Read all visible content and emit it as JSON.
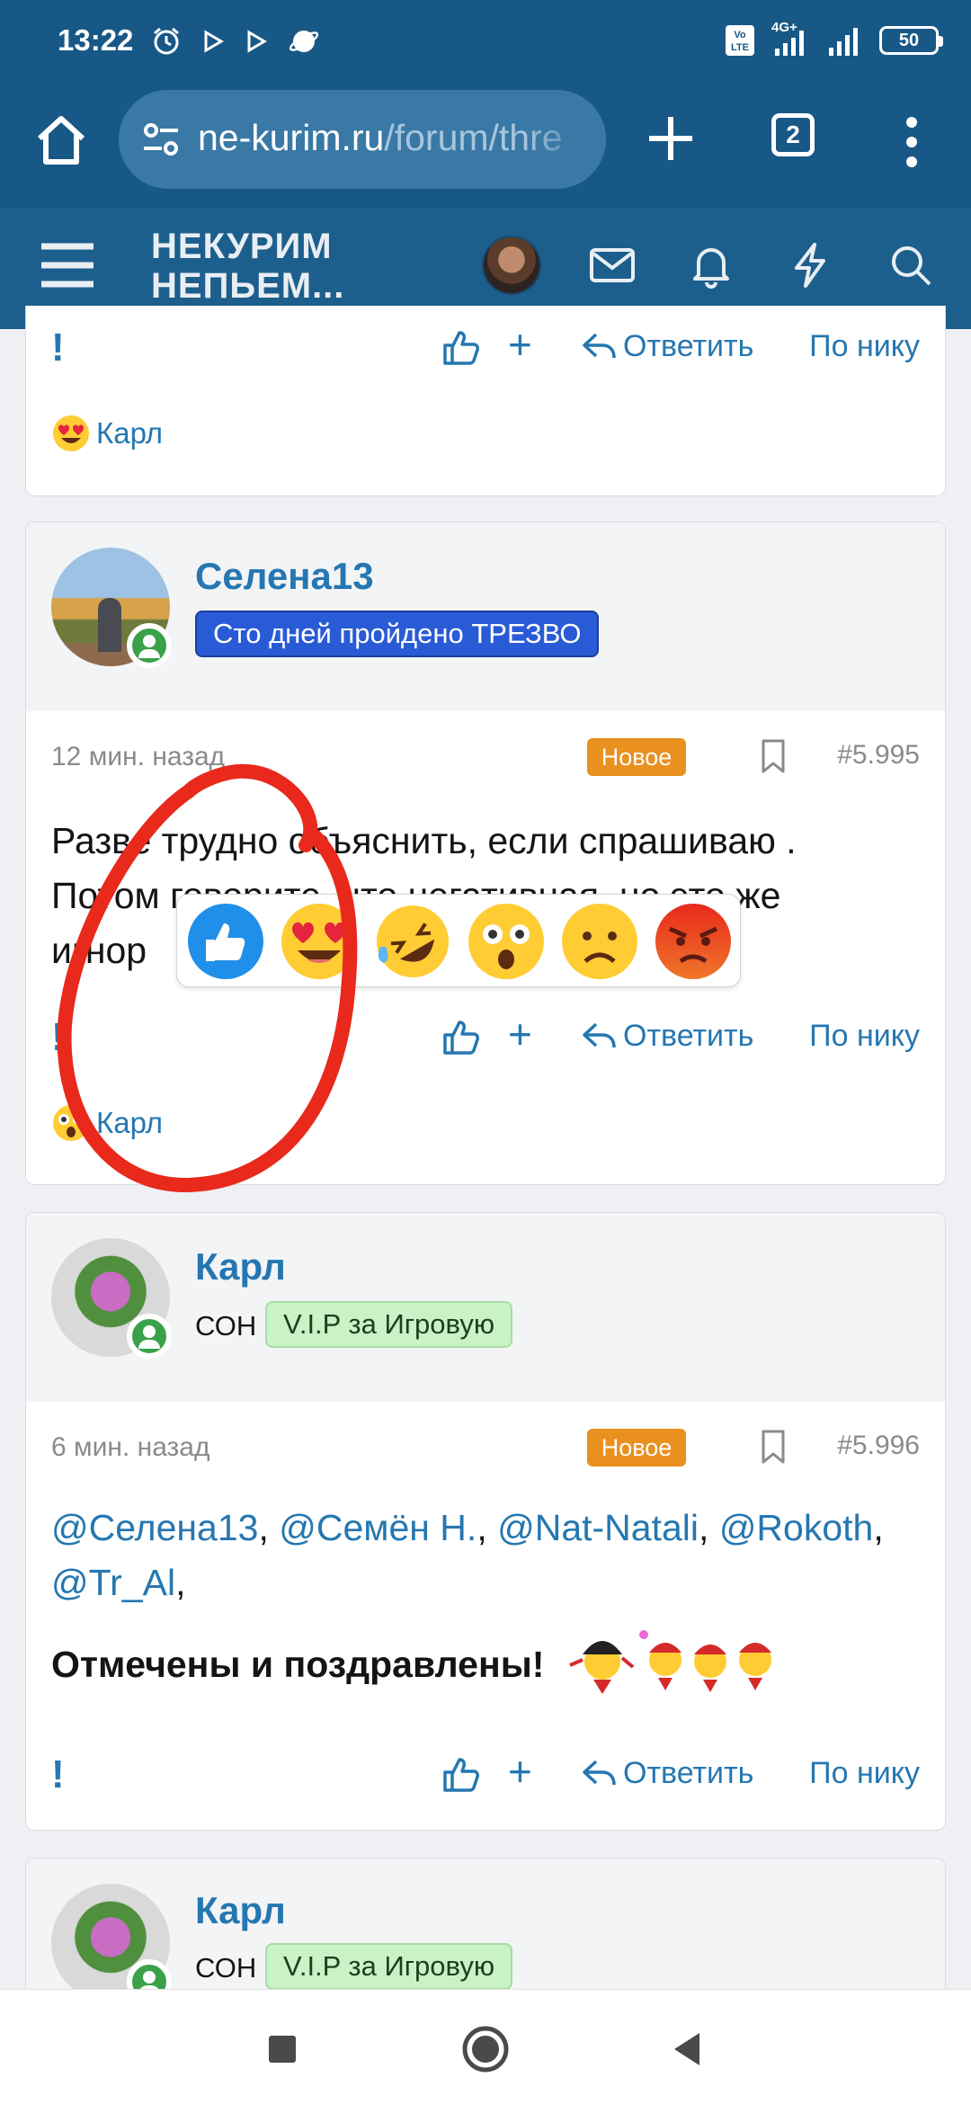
{
  "status_bar": {
    "time": "13:22",
    "network": "4G+",
    "battery": "50",
    "icons": [
      "alarm-icon",
      "play-icon",
      "play-icon",
      "planet-icon",
      "volte-icon",
      "signal-icon",
      "signal-icon",
      "battery-icon"
    ]
  },
  "browser": {
    "url_domain": "ne-kurim.ru",
    "url_path": "/forum/thre",
    "tab_count": "2"
  },
  "forum": {
    "logo_line1": "НЕКУРИМ",
    "logo_line2": "НЕПЬЕМ..."
  },
  "post_prev": {
    "actions": {
      "reply": "Ответить",
      "by_nick": "По нику"
    },
    "reaction_user": "Карл",
    "reaction": "heart-eyes"
  },
  "post1": {
    "username": "Селена13",
    "badge": "Сто дней пройдено ТРЕЗВО",
    "time": "12 мин. назад",
    "new_label": "Новое",
    "number": "#5.995",
    "text_line1": "Разве трудно объяснить, если спрашиваю .",
    "text_line2": "Потом говорите, что негативная, но это же",
    "text_line3": "игнор",
    "actions": {
      "reply": "Ответить",
      "by_nick": "По нику"
    },
    "reaction_user": "Карл",
    "reaction": "astonished"
  },
  "reaction_popup": {
    "items": [
      "like",
      "love",
      "rofl",
      "wow",
      "sad",
      "angry"
    ]
  },
  "post2": {
    "username": "Карл",
    "title": "СОН",
    "badge": "V.I.P за Игровую",
    "time": "6 мин. назад",
    "new_label": "Новое",
    "number": "#5.996",
    "mentions": [
      "@Селена13",
      "@Семён Н.",
      "@Nat-Natali",
      "@Rokoth",
      "@Tr_Al"
    ],
    "text_bold": "Отмечены и поздравлены!",
    "actions": {
      "reply": "Ответить",
      "by_nick": "По нику"
    }
  },
  "post3": {
    "username": "Карл",
    "title": "СОН",
    "badge": "V.I.P за Игровую"
  },
  "colors": {
    "header_blue": "#185886",
    "link_blue": "#2577b1",
    "new_orange": "#e9901e",
    "online_green": "#3aa14a",
    "annotation_red": "#e8291c"
  }
}
